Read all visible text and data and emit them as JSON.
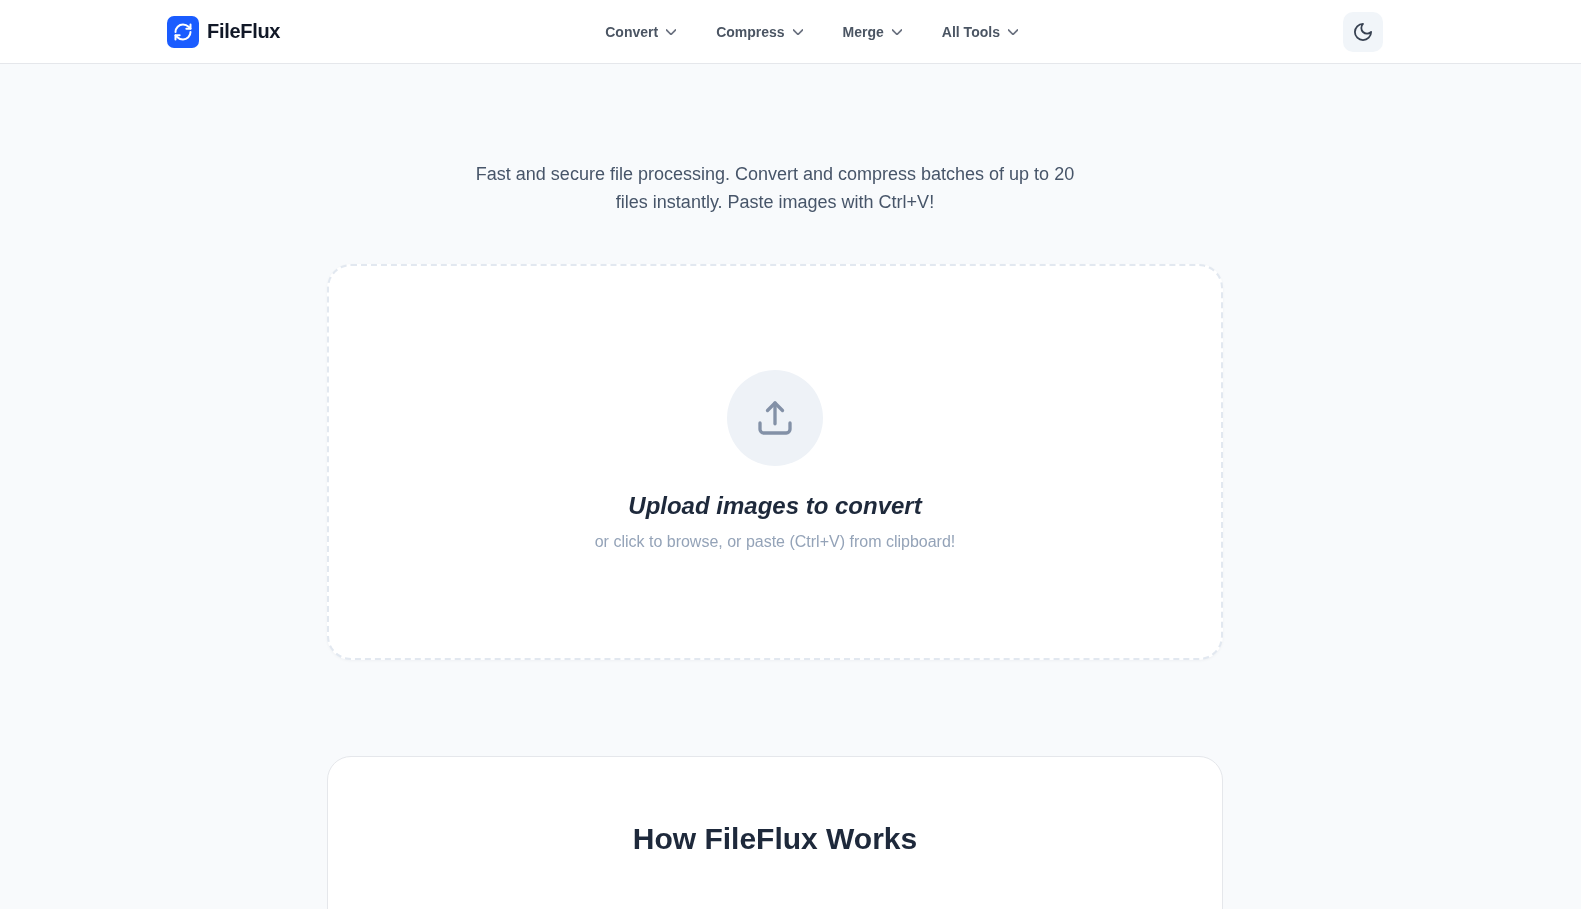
{
  "header": {
    "brand": "FileFlux",
    "nav": [
      {
        "label": "Convert"
      },
      {
        "label": "Compress"
      },
      {
        "label": "Merge"
      },
      {
        "label": "All Tools"
      }
    ]
  },
  "tagline": "Fast and secure file processing. Convert and compress batches of up to 20 files instantly. Paste images with Ctrl+V!",
  "upload": {
    "title": "Upload images to convert",
    "hint": "or click to browse, or paste (Ctrl+V) from clipboard!"
  },
  "how_it_works": {
    "title": "How FileFlux Works"
  }
}
